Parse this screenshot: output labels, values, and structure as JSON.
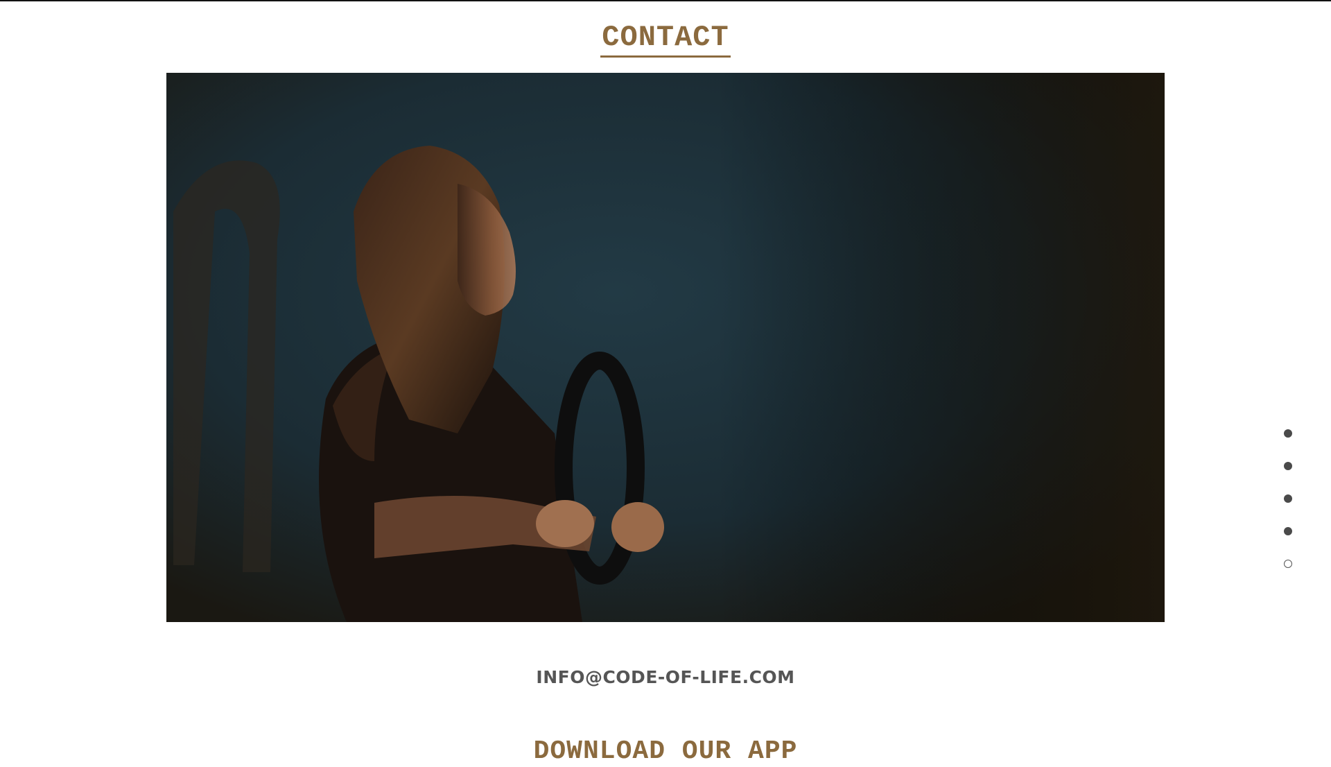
{
  "section": {
    "title": "CONTACT"
  },
  "hero": {
    "description": "",
    "colors": {
      "shadow_teal": "#1b2d36",
      "shadow_warm": "#1c1810",
      "accent": "#8b6a3e"
    }
  },
  "contact": {
    "email": "INFO@CODE-OF-LIFE.COM"
  },
  "next_section": {
    "title": "DOWNLOAD OUR APP"
  },
  "page_nav": {
    "count": 5,
    "active_index": 4
  }
}
